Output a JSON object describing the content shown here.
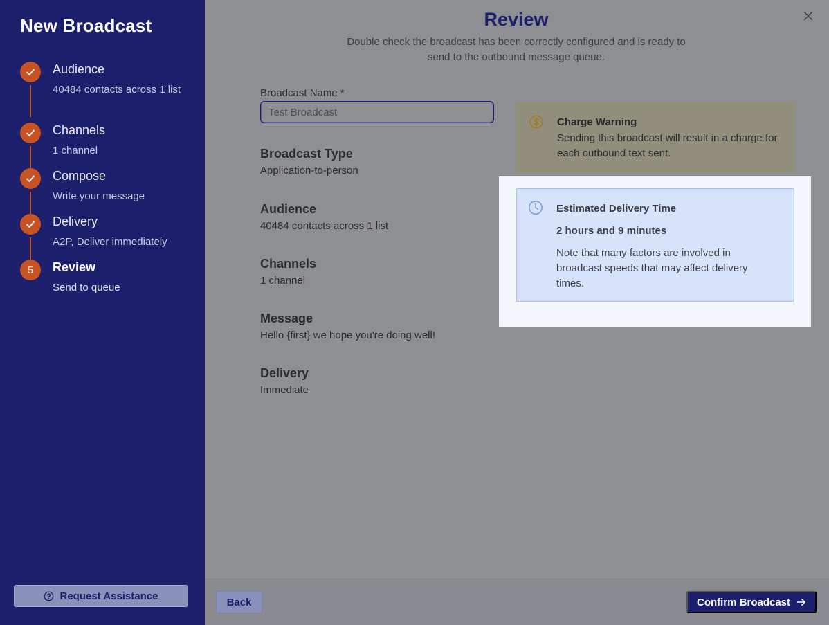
{
  "sidebar": {
    "title": "New Broadcast",
    "steps": [
      {
        "label": "Audience",
        "subtitle": "40484 contacts across 1 list",
        "status": "complete"
      },
      {
        "label": "Channels",
        "subtitle": "1 channel",
        "status": "complete"
      },
      {
        "label": "Compose",
        "subtitle": "Write your message",
        "status": "complete"
      },
      {
        "label": "Delivery",
        "subtitle": "A2P, Deliver immediately",
        "status": "complete"
      },
      {
        "label": "Review",
        "subtitle": "Send to queue",
        "status": "active",
        "number": "5"
      }
    ],
    "assist_label": "Request Assistance"
  },
  "main": {
    "title": "Review",
    "subtitle": "Double check the broadcast has been correctly configured and is ready to send to the outbound message queue.",
    "name_field": {
      "label": "Broadcast Name *",
      "value": "Test Broadcast"
    },
    "summary": [
      {
        "heading": "Broadcast Type",
        "value": "Application-to-person"
      },
      {
        "heading": "Audience",
        "value": "40484 contacts across 1 list"
      },
      {
        "heading": "Channels",
        "value": "1 channel"
      },
      {
        "heading": "Message",
        "value": "Hello {first} we hope you're doing well!"
      },
      {
        "heading": "Delivery",
        "value": "Immediate"
      }
    ],
    "charge_warning": {
      "title": "Charge Warning",
      "text": "Sending this broadcast will result in a charge for each outbound text sent.",
      "icon": "dollar-circle-icon"
    },
    "delivery_estimate": {
      "title": "Estimated Delivery Time",
      "time": "2 hours and 9 minutes",
      "note": "Note that many factors are involved in broadcast speeds that may affect delivery times.",
      "icon": "clock-icon"
    }
  },
  "footer": {
    "back_label": "Back",
    "confirm_label": "Confirm Broadcast"
  },
  "colors": {
    "sidebar_bg": "#1c1f6c",
    "step_accent": "#c75325",
    "overlay": "#8e8f93",
    "highlight_box": "#d6e3fb"
  }
}
